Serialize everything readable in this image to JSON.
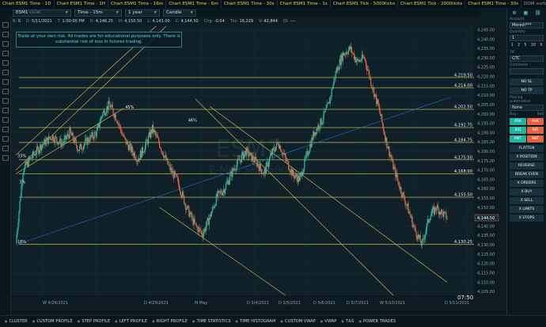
{
  "tabs": [
    "Chart ESM1 Time - 1D",
    "Chart ESM1 Time - 1H",
    "Chart ESM1 Time - 16m",
    "Chart ESM1 Time - 6m",
    "Chart ESM1 Time - 30s",
    "Chart ESM1 Time - 1s",
    "Chart ESM1 Tick - 5000ticks",
    "Chart ESM1 Tick - 2000ticks",
    "Chart ESM1 Time - 30s",
    "DOM surface ESM1"
  ],
  "toolbar": {
    "symbol": "ESM1",
    "symbol_sub": "ESEMC",
    "timeframe": "Time - 15m",
    "range": "1 year",
    "style": "Candle"
  },
  "ohlc": [
    {
      "k": "B:",
      "v": "0"
    },
    {
      "k": "D:",
      "v": "5/11/2021"
    },
    {
      "k": "T:",
      "v": "1:00:00 PM"
    },
    {
      "k": "O:",
      "v": "4,146.25"
    },
    {
      "k": "H:",
      "v": "4,150.50"
    },
    {
      "k": "L:",
      "v": "4,143.00"
    },
    {
      "k": "C:",
      "v": "4,144.50"
    },
    {
      "k": "Chg:",
      "v": "-0.04"
    },
    {
      "k": "Tks:",
      "v": "16,229"
    },
    {
      "k": "V:",
      "v": "42,844"
    },
    {
      "k": "OI:",
      "v": "----"
    }
  ],
  "disclaimer": "Trade at your own risk. All trades are for educational purposes only. There is substantial risk of loss in futures trading.",
  "watermark": {
    "symbol": "ESM1",
    "name": "E-Mini S&P 500"
  },
  "clock": "07:50",
  "chart_data": {
    "type": "candlestick",
    "instrument": "ESM1",
    "timeframe": "15m",
    "ylim": [
      4103,
      4247
    ],
    "y_ticks": [
      4105,
      4110,
      4115,
      4120,
      4125,
      4130,
      4135,
      4140,
      4145,
      4150,
      4155,
      4160,
      4165,
      4170,
      4175,
      4180,
      4185,
      4190,
      4195,
      4200,
      4205,
      4210,
      4215,
      4220,
      4225,
      4230,
      4235,
      4240,
      4245
    ],
    "x_labels": [
      "W 4/26/2021",
      "D 4/29/2021",
      "M May",
      "D 5/4/2021",
      "D 5/5/2021",
      "D 5/6/2021",
      "D 5/7/2021",
      "W 5/10/2021",
      "D 5/11/2021"
    ],
    "horizontal_levels": [
      4219.5,
      4214.0,
      4202.5,
      4192.75,
      4184.75,
      4175.5,
      4168.0,
      4155.5,
      4130.25
    ],
    "last_price": 4144.5,
    "close_path": [
      [
        0,
        4131
      ],
      [
        4,
        4170
      ],
      [
        8,
        4176
      ],
      [
        14,
        4183
      ],
      [
        20,
        4188
      ],
      [
        26,
        4184
      ],
      [
        30,
        4190
      ],
      [
        35,
        4181
      ],
      [
        40,
        4186
      ],
      [
        45,
        4190
      ],
      [
        48,
        4200
      ],
      [
        52,
        4205
      ],
      [
        56,
        4198
      ],
      [
        60,
        4187
      ],
      [
        64,
        4181
      ],
      [
        68,
        4176
      ],
      [
        72,
        4183
      ],
      [
        76,
        4192
      ],
      [
        80,
        4184
      ],
      [
        85,
        4172
      ],
      [
        90,
        4164
      ],
      [
        95,
        4150
      ],
      [
        100,
        4140
      ],
      [
        104,
        4136
      ],
      [
        108,
        4145
      ],
      [
        112,
        4156
      ],
      [
        116,
        4160
      ],
      [
        122,
        4172
      ],
      [
        128,
        4180
      ],
      [
        134,
        4174
      ],
      [
        138,
        4168
      ],
      [
        142,
        4178
      ],
      [
        146,
        4185
      ],
      [
        150,
        4176
      ],
      [
        154,
        4168
      ],
      [
        158,
        4165
      ],
      [
        162,
        4178
      ],
      [
        166,
        4190
      ],
      [
        170,
        4196
      ],
      [
        174,
        4205
      ],
      [
        178,
        4222
      ],
      [
        182,
        4232
      ],
      [
        186,
        4235
      ],
      [
        190,
        4228
      ],
      [
        194,
        4230
      ],
      [
        198,
        4216
      ],
      [
        202,
        4203
      ],
      [
        206,
        4186
      ],
      [
        210,
        4172
      ],
      [
        214,
        4160
      ],
      [
        218,
        4150
      ],
      [
        222,
        4138
      ],
      [
        226,
        4130
      ],
      [
        230,
        4145
      ],
      [
        234,
        4150
      ],
      [
        240,
        4144.5
      ]
    ],
    "trend_lines": [
      {
        "x1": 0,
        "y1": 4170,
        "x2": 100,
        "y2": 4262,
        "color": "#e6dc5a"
      },
      {
        "x1": 0,
        "y1": 4178,
        "x2": 95,
        "y2": 4262,
        "color": "#e6dc5a"
      },
      {
        "x1": 0,
        "y1": 4168,
        "x2": 60,
        "y2": 4203,
        "color": "#e6dc5a"
      },
      {
        "x1": 100,
        "y1": 4208,
        "x2": 210,
        "y2": 4103,
        "color": "#e6dc5a"
      },
      {
        "x1": 108,
        "y1": 4204,
        "x2": 240,
        "y2": 4110,
        "color": "#e6dc5a"
      },
      {
        "x1": 80,
        "y1": 4150,
        "x2": 150,
        "y2": 4103,
        "color": "#e6dc5a"
      },
      {
        "x1": 0,
        "y1": 4130,
        "x2": 242,
        "y2": 4209,
        "color": "#2f6fd8"
      }
    ],
    "annotations": [
      {
        "x": 0,
        "y": 4177,
        "text": "33%"
      },
      {
        "x": 1,
        "y": 4163,
        "text": "3%"
      },
      {
        "x": 0,
        "y": 4131,
        "text": "18%"
      },
      {
        "x": 60,
        "y": 4203,
        "text": "45%"
      },
      {
        "x": 95,
        "y": 4196,
        "text": "46%"
      }
    ]
  },
  "panel": {
    "account_label": "Account",
    "account": "Meredi***",
    "quantity_label": "Quantity",
    "quantity": "1",
    "quick_qty": [
      "1",
      "2",
      "5",
      "10",
      "X"
    ],
    "tif_label": "TIF",
    "tif": "GTC",
    "comment_label": "Comment",
    "no_sl": "NO SL",
    "no_tp": "NO TP",
    "placing_label": "Placing automation",
    "placing": "None",
    "buy_label": "Buy",
    "sell_label": "Sell",
    "ask": "ASK",
    "bid": "BID",
    "mkt": "MKT",
    "actions": [
      "FLATTEN",
      "X POSITION",
      "REVERSE",
      "BREAK EVEN",
      "X ORDERS",
      "X BUY",
      "X SELL",
      "X LIMITS",
      "X STOPS"
    ]
  },
  "bottombar": [
    "CLUSTER",
    "CUSTOM PROFILE",
    "STEP PROFILE",
    "LEFT PROFILE",
    "RIGHT PROFILE",
    "TIME STATISTICS",
    "TIME HISTOGRAM",
    "CUSTOM VWAP",
    "VWAP",
    "T&S",
    "POWER TRADES"
  ]
}
